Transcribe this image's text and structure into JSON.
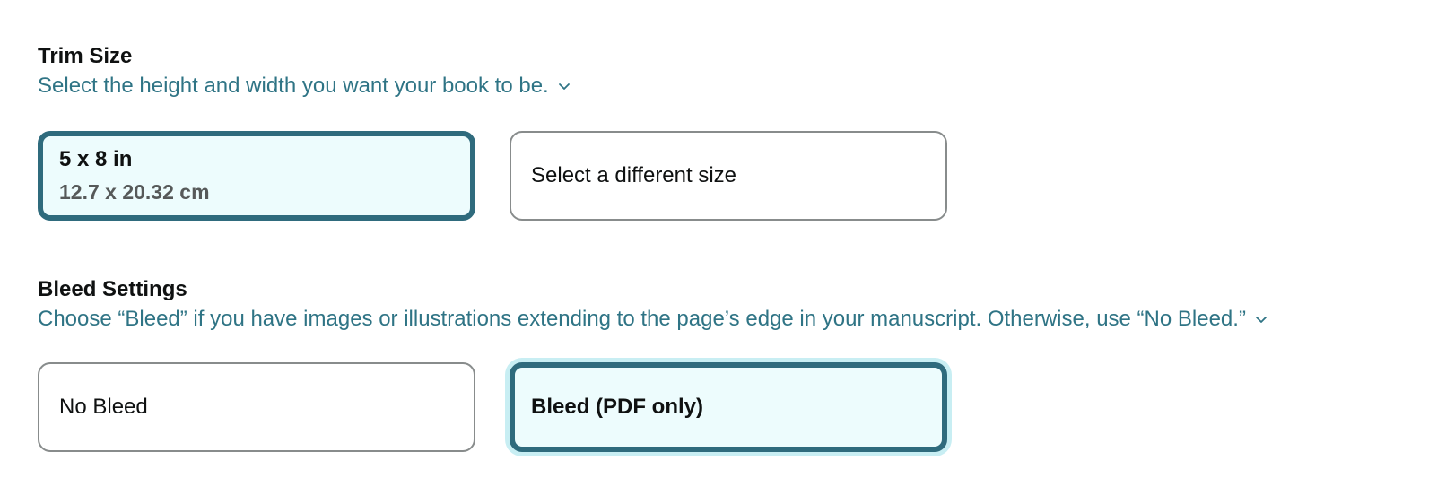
{
  "trim_size": {
    "title": "Trim Size",
    "description": "Select the height and width you want your book to be.",
    "description_icon": "chevron-down-icon",
    "options": [
      {
        "label": "5 x 8 in",
        "sublabel": "12.7 x 20.32 cm",
        "selected": true
      },
      {
        "label": "Select a different size",
        "selected": false
      }
    ]
  },
  "bleed_settings": {
    "title": "Bleed Settings",
    "description": "Choose “Bleed” if you have images or illustrations extending to the page’s edge in your manuscript. Otherwise, use “No Bleed.”",
    "description_icon": "chevron-down-icon",
    "options": [
      {
        "label": "No Bleed",
        "selected": false
      },
      {
        "label": "Bleed (PDF only)",
        "selected": true
      }
    ]
  },
  "colors": {
    "accent_border": "#2f6b7d",
    "selected_background": "#edfcfd",
    "link_text": "#2f7485",
    "focus_ring": "#c8eef3"
  }
}
